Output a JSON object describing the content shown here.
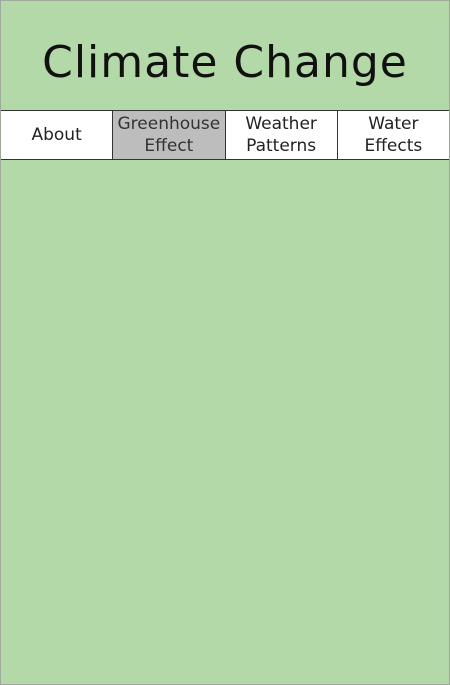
{
  "header": {
    "title": "Climate Change"
  },
  "nav": {
    "tabs": [
      {
        "label": "About",
        "active": false
      },
      {
        "label": "Greenhouse\nEffect",
        "active": true
      },
      {
        "label": "Weather\nPatterns",
        "active": false
      },
      {
        "label": "Water\nEffects",
        "active": false
      }
    ]
  },
  "colors": {
    "background": "#b3d9a9",
    "active_tab": "#bdbdbd"
  }
}
